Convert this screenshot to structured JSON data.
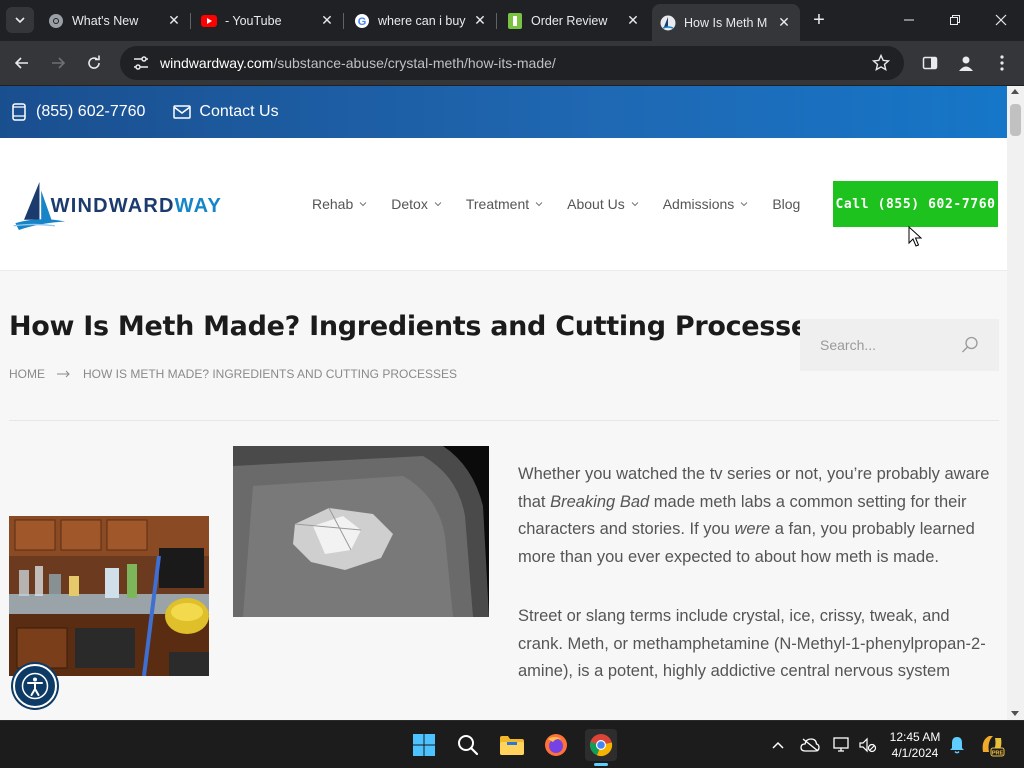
{
  "browser": {
    "tabs": [
      {
        "title": "What's New",
        "icon": "chrome-icon"
      },
      {
        "title": "- YouTube",
        "icon": "youtube-icon"
      },
      {
        "title": "where can i buy",
        "icon": "google-icon"
      },
      {
        "title": "Order Review",
        "icon": "order-review-icon"
      },
      {
        "title": "How Is Meth M",
        "icon": "windwardway-icon",
        "active": true
      }
    ],
    "url_host": "windwardway.com",
    "url_path": "/substance-abuse/crystal-meth/how-its-made/"
  },
  "site": {
    "topbar": {
      "phone": "(855) 602-7760",
      "contact": "Contact Us"
    },
    "logo": {
      "word_a": "WINDWARD",
      "word_b": "WAY"
    },
    "nav": [
      {
        "label": "Rehab",
        "dropdown": true
      },
      {
        "label": "Detox",
        "dropdown": true
      },
      {
        "label": "Treatment",
        "dropdown": true
      },
      {
        "label": "About Us",
        "dropdown": true
      },
      {
        "label": "Admissions",
        "dropdown": true
      },
      {
        "label": "Blog",
        "dropdown": false
      }
    ],
    "cta": "Call (855) 602-7760",
    "cta_color": "#1ec21e"
  },
  "page": {
    "title": "How Is Meth Made? Ingredients and Cutting Processes",
    "breadcrumb": {
      "home": "HOME",
      "current": "HOW IS METH MADE? INGREDIENTS AND CUTTING PROCESSES"
    },
    "search_placeholder": "Search...",
    "paragraph1": {
      "a": "Whether you watched the tv series or not, you’re probably aware that ",
      "b_em": "Breaking Bad",
      "c": " made meth labs a common setting for their characters and stories. If you ",
      "d_em": "were",
      "e": " a fan, you probably learned more than you ever expected to about how meth is made."
    },
    "paragraph2": "Street or slang terms include crystal, ice, crissy, tweak, and crank. Meth, or methamphetamine (N-Methyl-1-phenylpropan-2-amine), is a potent, highly addictive central nervous system"
  },
  "taskbar": {
    "time": "12:45 AM",
    "date": "4/1/2024"
  }
}
